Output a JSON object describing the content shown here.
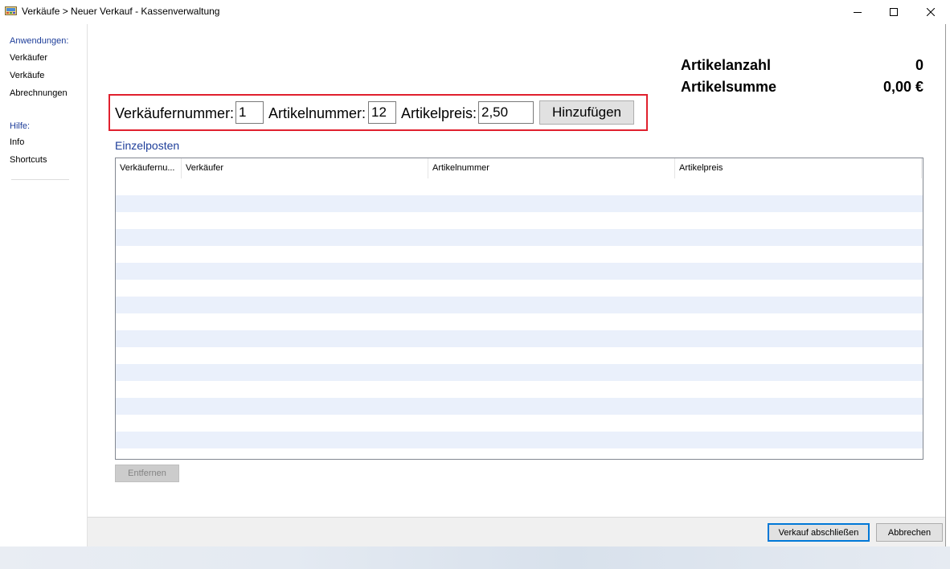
{
  "window": {
    "title": "Verkäufe > Neuer Verkauf - Kassenverwaltung"
  },
  "sidebar": {
    "applications_heading": "Anwendungen:",
    "applications": [
      {
        "label": "Verkäufer"
      },
      {
        "label": "Verkäufe"
      },
      {
        "label": "Abrechnungen"
      }
    ],
    "help_heading": "Hilfe:",
    "help": [
      {
        "label": "Info"
      },
      {
        "label": "Shortcuts"
      }
    ]
  },
  "summary": {
    "count_label": "Artikelanzahl",
    "count_value": "0",
    "sum_label": "Artikelsumme",
    "sum_value": "0,00 €"
  },
  "entry": {
    "seller_label": "Verkäufernummer:",
    "seller_value": "1",
    "article_label": "Artikelnummer:",
    "article_value": "12",
    "price_label": "Artikelpreis:",
    "price_value": "2,50",
    "add_button": "Hinzufügen"
  },
  "items": {
    "title": "Einzelposten",
    "columns": [
      "Verkäufernu...",
      "Verkäufer",
      "Artikelnummer",
      "Artikelpreis"
    ],
    "rows": [],
    "stripe_color": "#eaf0fb",
    "remove_button": "Entfernen"
  },
  "footer": {
    "finish_button": "Verkauf abschließen",
    "cancel_button": "Abbrechen"
  },
  "colors": {
    "accent": "#1e3e9a",
    "highlight_border": "#e0202e",
    "default_button_border": "#0078d7"
  }
}
